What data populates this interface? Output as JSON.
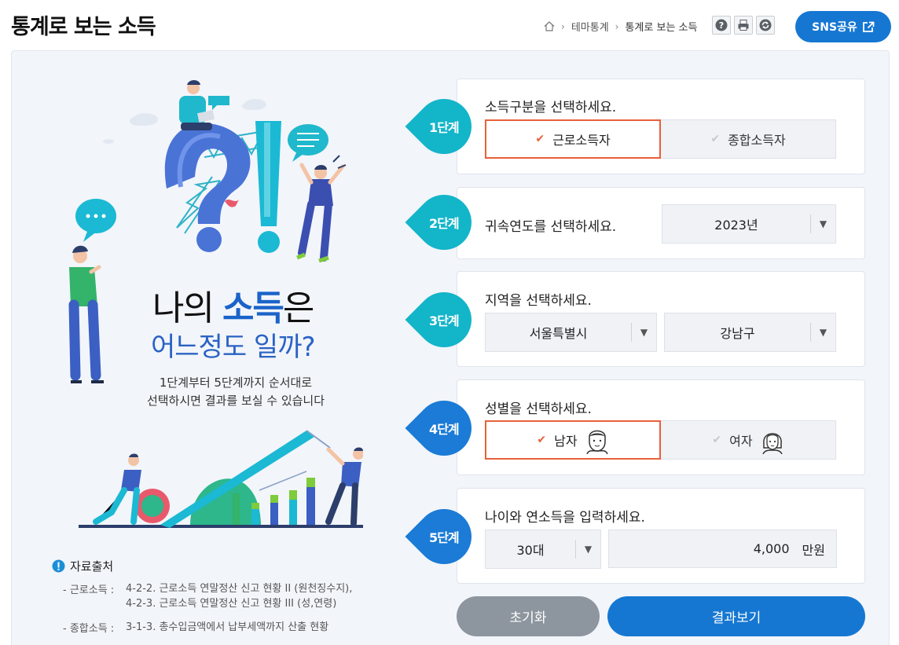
{
  "header": {
    "title": "통계로 보는 소득",
    "breadcrumb": [
      "테마통계",
      "통계로 보는 소득"
    ],
    "tools": [
      "help-icon",
      "print-icon",
      "refresh-icon"
    ],
    "sns_label": "SNS공유"
  },
  "hero": {
    "line1_a": "나의 ",
    "line1_accent": "소득",
    "line1_b": "은",
    "line2": "어느정도 일까?",
    "desc_line1": "1단계부터 5단계까지 순서대로",
    "desc_line2": "선택하시면 결과를 보실 수 있습니다"
  },
  "sources": {
    "title": "자료출처",
    "items": [
      {
        "key": "- 근로소득 :",
        "lines": [
          "4-2-2. 근로소득 연말정산 신고 현황 II (원천징수지),",
          "4-2-3. 근로소득 연말정산 신고 현황 III (성,연령)"
        ]
      },
      {
        "key": "- 종합소득 :",
        "lines": [
          "3-1-3. 총수입금액에서 납부세액까지 산출 현황"
        ]
      }
    ]
  },
  "steps": {
    "s1": {
      "badge": "1단계",
      "question": "소득구분을 선택하세요.",
      "options": [
        "근로소득자",
        "종합소득자"
      ],
      "selected": 0
    },
    "s2": {
      "badge": "2단계",
      "question": "귀속연도를 선택하세요.",
      "year": "2023년"
    },
    "s3": {
      "badge": "3단계",
      "question": "지역을 선택하세요.",
      "region": "서울특별시",
      "district": "강남구"
    },
    "s4": {
      "badge": "4단계",
      "question": "성별을 선택하세요.",
      "options": [
        "남자",
        "여자"
      ],
      "selected": 0
    },
    "s5": {
      "badge": "5단계",
      "question": "나이와 연소득을 입력하세요.",
      "age": "30대",
      "income": "4,000",
      "unit": "만원"
    }
  },
  "buttons": {
    "reset": "초기화",
    "result": "결과보기"
  },
  "colors": {
    "brand": "#1677d2",
    "selected_border": "#e8603a",
    "badge_teal": "#13b5c9",
    "badge_blue": "#1b7bd6"
  }
}
